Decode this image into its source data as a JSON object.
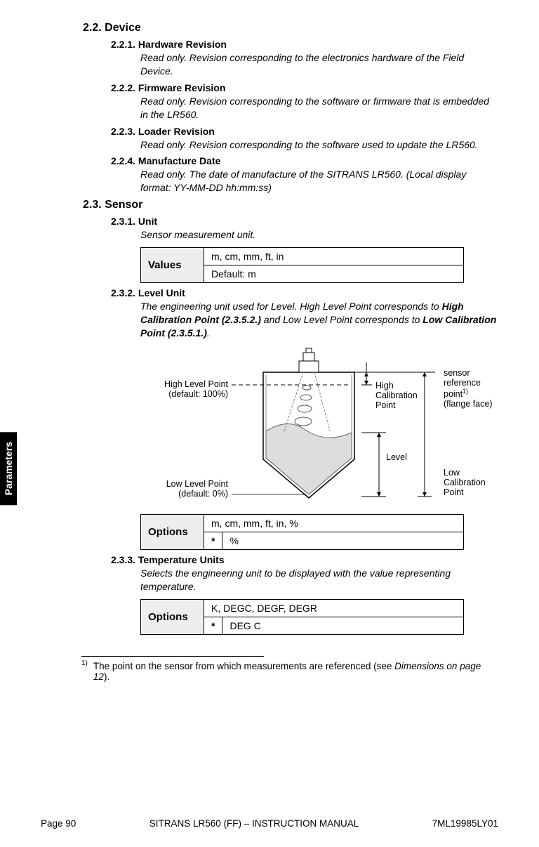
{
  "sidebar": {
    "label": "Parameters"
  },
  "s22": {
    "num": "2.2.",
    "title": "Device",
    "items": {
      "hardware": {
        "num": "2.2.1.",
        "title": "Hardware Revision",
        "desc": "Read only. Revision corresponding to the electronics hardware of the Field Device."
      },
      "firmware": {
        "num": "2.2.2.",
        "title": "Firmware Revision",
        "desc": "Read only. Revision corresponding to the software or firmware that is embedded in the LR560."
      },
      "loader": {
        "num": "2.2.3.",
        "title": "Loader Revision",
        "desc": "Read only. Revision corresponding to the software used to update the LR560."
      },
      "mfg": {
        "num": "2.2.4.",
        "title": "Manufacture Date",
        "desc": "Read only. The date of manufacture of the SITRANS LR560. (Local display format: YY-MM-DD hh:mm:ss)"
      }
    }
  },
  "s23": {
    "num": "2.3.",
    "title": "Sensor",
    "unit": {
      "num": "2.3.1.",
      "title": "Unit",
      "desc": "Sensor measurement unit.",
      "values_label": "Values",
      "values_row1": "m, cm, mm, ft, in",
      "values_row2": "Default: m"
    },
    "levelunit": {
      "num": "2.3.2.",
      "title": "Level Unit",
      "desc_pre": "The engineering unit used for Level. High Level Point corresponds to ",
      "desc_b1": "High Calibration Point (2.3.5.2.)",
      "desc_mid": " and Low Level Point corresponds to ",
      "desc_b2": "Low Calibration Point (2.3.5.1.)",
      "desc_post": ".",
      "options_label": "Options",
      "opt_row1": "m, cm, mm, ft, in, %",
      "opt_star": "*",
      "opt_row2": "%"
    },
    "tempunit": {
      "num": "2.3.3.",
      "title": "Temperature Units",
      "desc": "Selects the engineering unit to be displayed with the value representing temperature.",
      "options_label": "Options",
      "opt_row1": "K, DEGC, DEGF, DEGR",
      "opt_star": "*",
      "opt_row2": "DEG C"
    }
  },
  "diagram": {
    "high_level_point": "High Level Point",
    "high_level_default": "(default: 100%)",
    "low_level_point": "Low Level Point",
    "low_level_default": "(default: 0%)",
    "high_cal": "High\nCalibration\nPoint",
    "level": "Level",
    "sensor_ref_l1": "sensor",
    "sensor_ref_l2": "reference",
    "sensor_ref_l3": "point",
    "sensor_ref_sup": "1)",
    "sensor_ref_l4": "(flange face)",
    "low_cal": "Low\nCalibration\nPoint"
  },
  "footnote": {
    "mark": "1)",
    "text_pre": "The point on the sensor from which measurements are referenced (see ",
    "text_em": "Dimensions",
    "text_mid": " ",
    "text_em2": "on page 12",
    "text_post": ")."
  },
  "footer": {
    "left": "Page 90",
    "center": "SITRANS LR560 (FF) – INSTRUCTION MANUAL",
    "right": "7ML19985LY01"
  }
}
